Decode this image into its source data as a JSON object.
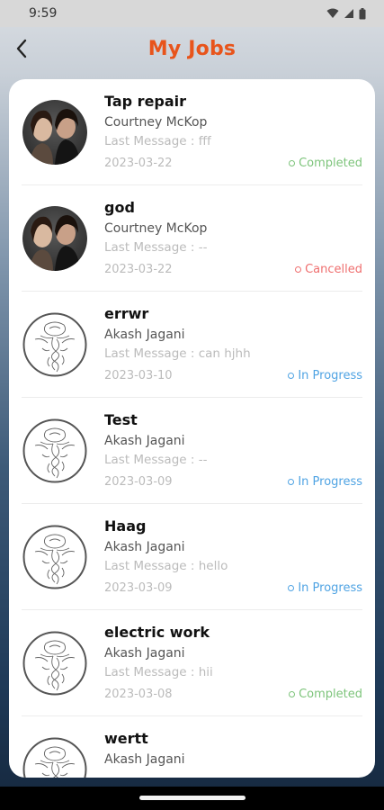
{
  "status_bar": {
    "time": "9:59"
  },
  "header": {
    "title": "My Jobs"
  },
  "colors": {
    "accent": "#e8541b",
    "completed": "#7dc47b",
    "cancelled": "#ef6f6f",
    "in_progress": "#4fa3e3"
  },
  "jobs": [
    {
      "title": "Tap repair",
      "person": "Courtney McKop",
      "last_message": "Last Message : fff",
      "date": "2023-03-22",
      "status": "Completed",
      "status_key": "completed",
      "avatar": "photo"
    },
    {
      "title": "god",
      "person": "Courtney McKop",
      "last_message": "Last Message : --",
      "date": "2023-03-22",
      "status": "Cancelled",
      "status_key": "cancelled",
      "avatar": "photo"
    },
    {
      "title": "errwr",
      "person": "Akash Jagani",
      "last_message": "Last Message : can hjhh",
      "date": "2023-03-10",
      "status": "In Progress",
      "status_key": "in_progress",
      "avatar": "sketch"
    },
    {
      "title": "Test",
      "person": "Akash Jagani",
      "last_message": "Last Message : --",
      "date": "2023-03-09",
      "status": "In Progress",
      "status_key": "in_progress",
      "avatar": "sketch"
    },
    {
      "title": "Haag",
      "person": "Akash Jagani",
      "last_message": "Last Message : hello",
      "date": "2023-03-09",
      "status": "In Progress",
      "status_key": "in_progress",
      "avatar": "sketch"
    },
    {
      "title": "electric work",
      "person": "Akash Jagani",
      "last_message": "Last Message : hii",
      "date": "2023-03-08",
      "status": "Completed",
      "status_key": "completed",
      "avatar": "sketch"
    },
    {
      "title": "wertt",
      "person": "Akash Jagani",
      "last_message": "",
      "date": "",
      "status": "",
      "status_key": "",
      "avatar": "sketch"
    }
  ]
}
